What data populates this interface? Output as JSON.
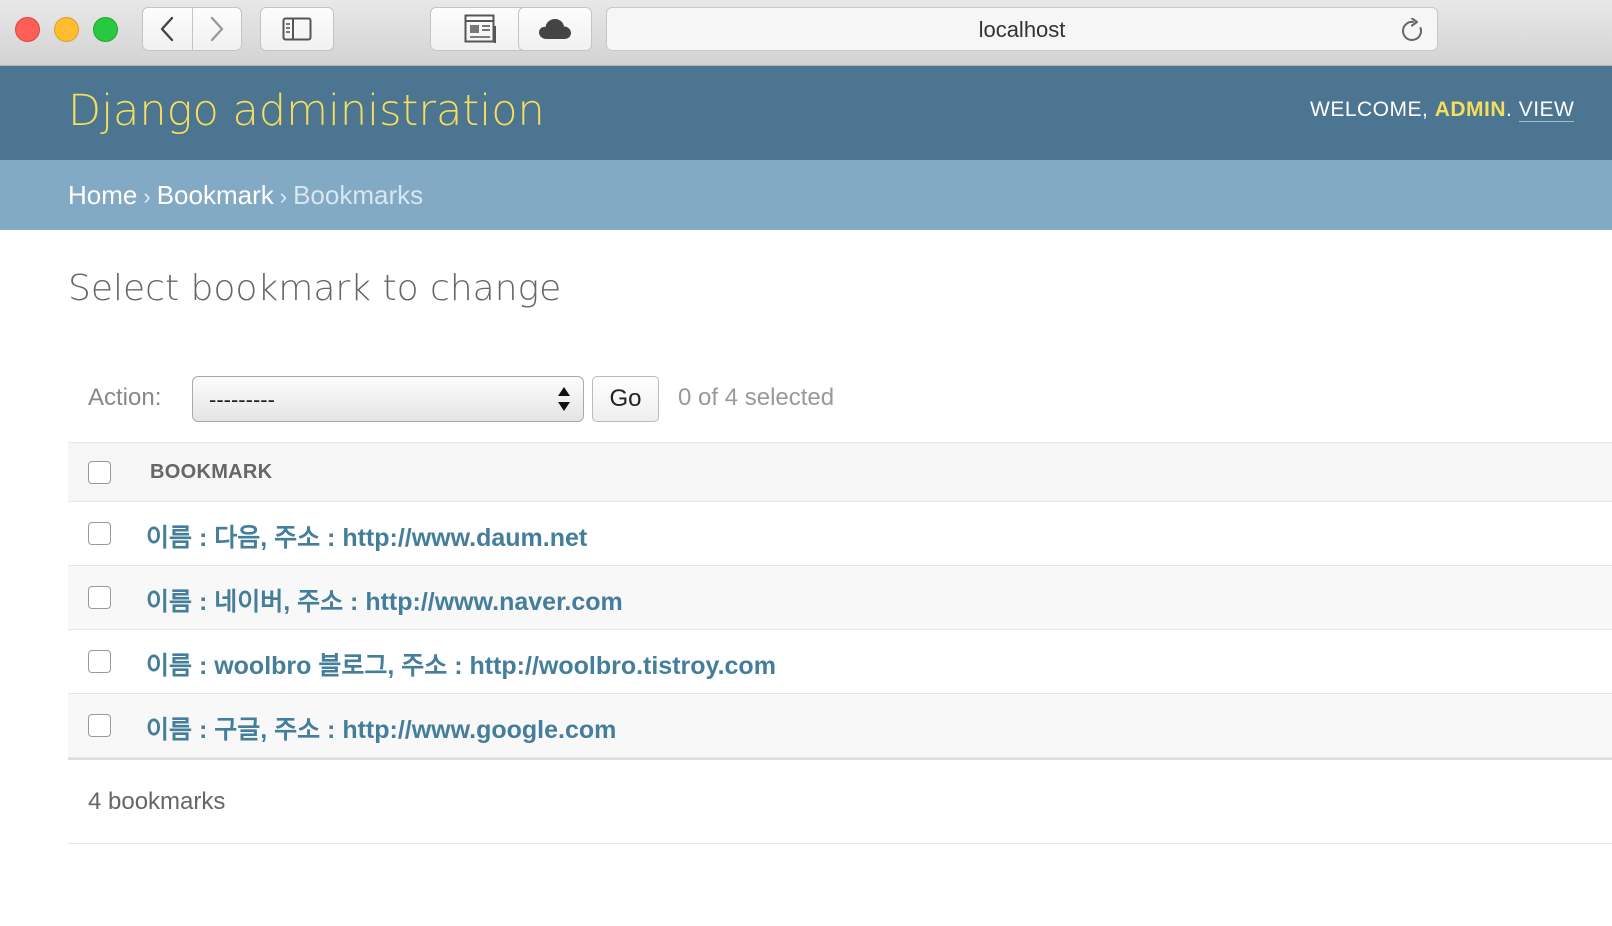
{
  "browser": {
    "url": "localhost",
    "buttons": {
      "back": "back-icon",
      "forward": "forward-icon",
      "sidebar": "sidebar-icon",
      "reader": "reader-icon",
      "cloud": "cloud-icon",
      "reload": "reload-icon"
    }
  },
  "header": {
    "site_title": "Django administration",
    "welcome": "WELCOME, ",
    "username": "ADMIN",
    "dot": ". ",
    "view_link": "VIEW"
  },
  "breadcrumbs": {
    "home": "Home",
    "app": "Bookmark",
    "current": "Bookmarks",
    "separator": "›"
  },
  "page": {
    "title": "Select bookmark to change"
  },
  "actions": {
    "label": "Action:",
    "selected_value": "---------",
    "go_label": "Go",
    "selected_count": "0 of 4 selected"
  },
  "table": {
    "column_header": "BOOKMARK",
    "rows": [
      {
        "label": "이름 : 다음, 주소 : http://www.daum.net"
      },
      {
        "label": "이름 : 네이버, 주소 : http://www.naver.com"
      },
      {
        "label": "이름 : woolbro 블로그, 주소 : http://woolbro.tistroy.com"
      },
      {
        "label": "이름 : 구글, 주소 : http://www.google.com"
      }
    ]
  },
  "paginator": {
    "count_text": "4 bookmarks"
  },
  "colors": {
    "header_bg": "#4b7590",
    "breadcrumb_bg": "#83aac5",
    "title_yellow": "#f5dd5d",
    "link_blue": "#447e9b"
  }
}
